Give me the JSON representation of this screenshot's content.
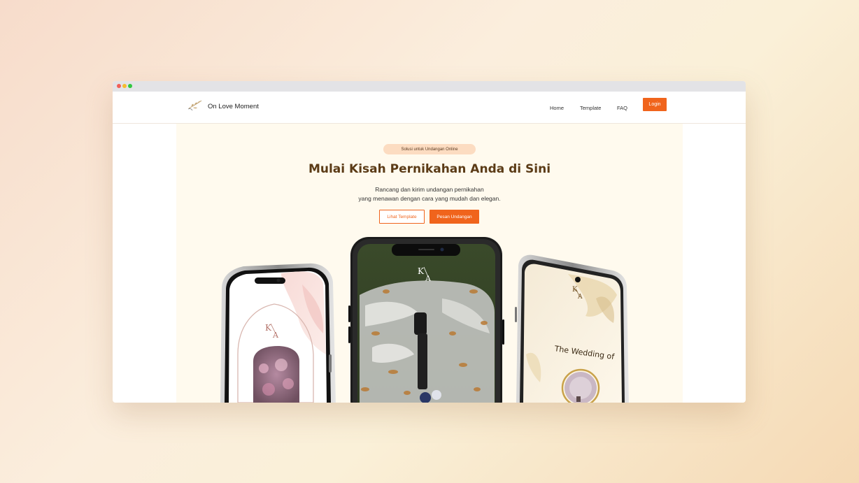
{
  "brand": {
    "name": "On Love Moment",
    "logo_icon": "leaf-monogram-icon"
  },
  "nav": {
    "home": "Home",
    "template": "Template",
    "faq": "FAQ",
    "login": "Login"
  },
  "hero": {
    "badge": "Solusi untuk Undangan Online",
    "title": "Mulai Kisah Pernikahan Anda di Sini",
    "subtitle_line1": "Rancang dan kirim undangan pernikahan",
    "subtitle_line2": "yang menawan dengan cara yang mudah dan elegan.",
    "btn_secondary": "Lihat Template",
    "btn_primary": "Pesan Undangan"
  },
  "mockups": {
    "left_monogram": "K/A",
    "center_monogram": "K/A",
    "right_monogram": "K/A",
    "right_caption": "The Wedding of"
  },
  "colors": {
    "accent": "#f0641c",
    "title": "#5b3b16",
    "hero_bg": "#fffaee",
    "badge_bg": "#fcdcc1"
  }
}
